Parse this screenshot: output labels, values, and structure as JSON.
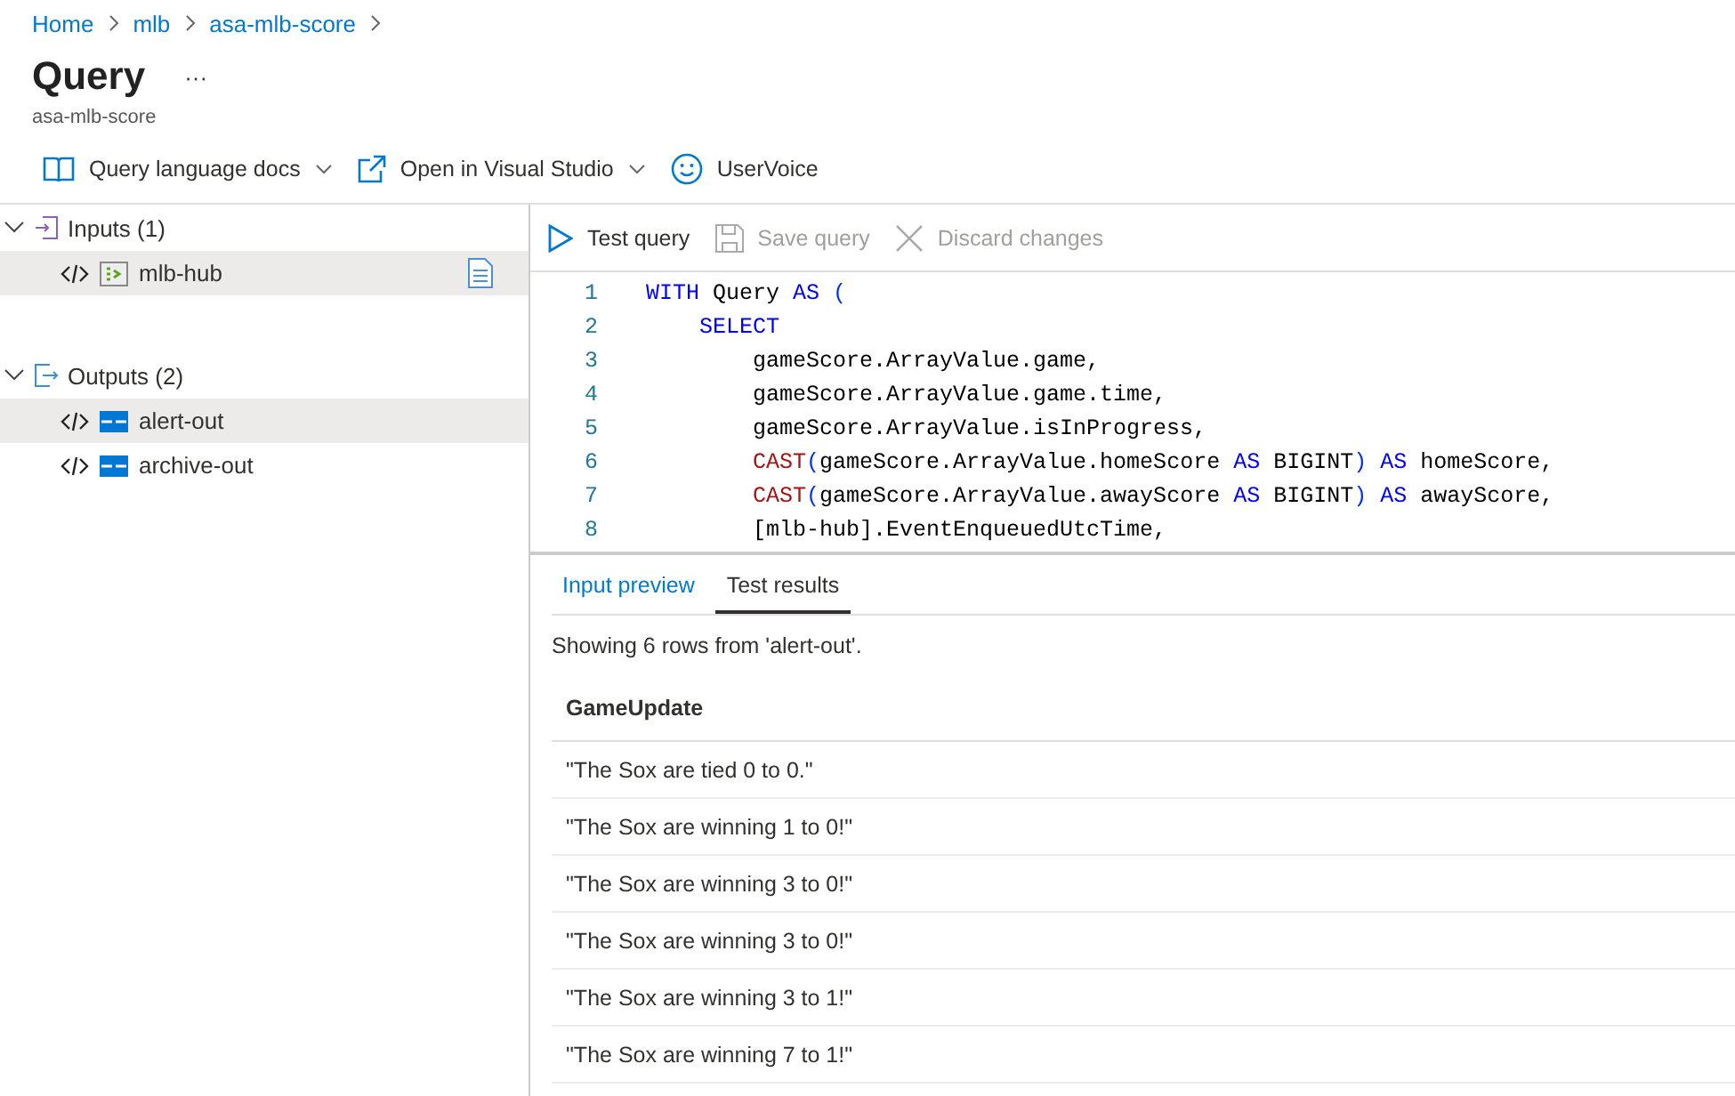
{
  "breadcrumb": [
    "Home",
    "mlb",
    "asa-mlb-score"
  ],
  "title": "Query",
  "more": "···",
  "subtitle": "asa-mlb-score",
  "toolbar": [
    {
      "kind": "book",
      "label": "Query language docs",
      "dropdown": true
    },
    {
      "kind": "external",
      "label": "Open in Visual Studio",
      "dropdown": true
    },
    {
      "kind": "smile",
      "label": "UserVoice",
      "dropdown": false
    }
  ],
  "sidebar": {
    "groups": [
      {
        "kind": "inputs",
        "label": "Inputs (1)",
        "expanded": true,
        "children": [
          {
            "kind": "hub",
            "label": "mlb-hub",
            "selected": true,
            "sample": true
          }
        ]
      },
      {
        "kind": "outputs",
        "label": "Outputs (2)",
        "expanded": true,
        "children": [
          {
            "kind": "table",
            "label": "alert-out",
            "selected": true,
            "sample": false
          },
          {
            "kind": "table",
            "label": "archive-out",
            "selected": false,
            "sample": false
          }
        ]
      }
    ]
  },
  "editor_toolbar": [
    {
      "kind": "play",
      "label": "Test query",
      "disabled": false
    },
    {
      "kind": "save",
      "label": "Save query",
      "disabled": true
    },
    {
      "kind": "discard",
      "label": "Discard changes",
      "disabled": true
    }
  ],
  "code": [
    {
      "number": "1",
      "tokens": [
        {
          "kind": "keyword",
          "text": "WITH"
        },
        {
          "kind": "text",
          "text": " Query "
        },
        {
          "kind": "keyword",
          "text": "AS"
        },
        {
          "kind": "punct",
          "text": " ("
        }
      ]
    },
    {
      "number": "2",
      "tokens": [
        {
          "kind": "keyword",
          "text": "    SELECT"
        }
      ]
    },
    {
      "number": "3",
      "tokens": [
        {
          "kind": "text",
          "text": "        gameScore.ArrayValue.game,"
        }
      ]
    },
    {
      "number": "4",
      "tokens": [
        {
          "kind": "text",
          "text": "        gameScore.ArrayValue.game.time,"
        }
      ]
    },
    {
      "number": "5",
      "tokens": [
        {
          "kind": "text",
          "text": "        gameScore.ArrayValue.isInProgress,"
        }
      ]
    },
    {
      "number": "6",
      "tokens": [
        {
          "kind": "function",
          "text": "        CAST"
        },
        {
          "kind": "punct",
          "text": "("
        },
        {
          "kind": "text",
          "text": "gameScore.ArrayValue.homeScore "
        },
        {
          "kind": "keyword",
          "text": "AS"
        },
        {
          "kind": "text",
          "text": " BIGINT"
        },
        {
          "kind": "punct",
          "text": ")"
        },
        {
          "kind": "keyword",
          "text": " AS"
        },
        {
          "kind": "text",
          "text": " homeScore,"
        }
      ]
    },
    {
      "number": "7",
      "tokens": [
        {
          "kind": "function",
          "text": "        CAST"
        },
        {
          "kind": "punct",
          "text": "("
        },
        {
          "kind": "text",
          "text": "gameScore.ArrayValue.awayScore "
        },
        {
          "kind": "keyword",
          "text": "AS"
        },
        {
          "kind": "text",
          "text": " BIGINT"
        },
        {
          "kind": "punct",
          "text": ")"
        },
        {
          "kind": "keyword",
          "text": " AS"
        },
        {
          "kind": "text",
          "text": " awayScore,"
        }
      ]
    },
    {
      "number": "8",
      "tokens": [
        {
          "kind": "text",
          "text": "        [mlb-hub].EventEnqueuedUtcTime,"
        }
      ]
    }
  ],
  "result_tabs": [
    {
      "label": "Input preview",
      "selected": false
    },
    {
      "label": "Test results",
      "selected": true
    }
  ],
  "result_summary": "Showing 6 rows from 'alert-out'.",
  "table": {
    "columns": [
      "GameUpdate"
    ],
    "rows": [
      [
        "\"The Sox are tied 0 to 0.\""
      ],
      [
        "\"The Sox are winning 1 to 0!\""
      ],
      [
        "\"The Sox are winning 3 to 0!\""
      ],
      [
        "\"The Sox are winning 3 to 0!\""
      ],
      [
        "\"The Sox are winning 3 to 1!\""
      ],
      [
        "\"The Sox are winning 7 to 1!\""
      ]
    ]
  }
}
